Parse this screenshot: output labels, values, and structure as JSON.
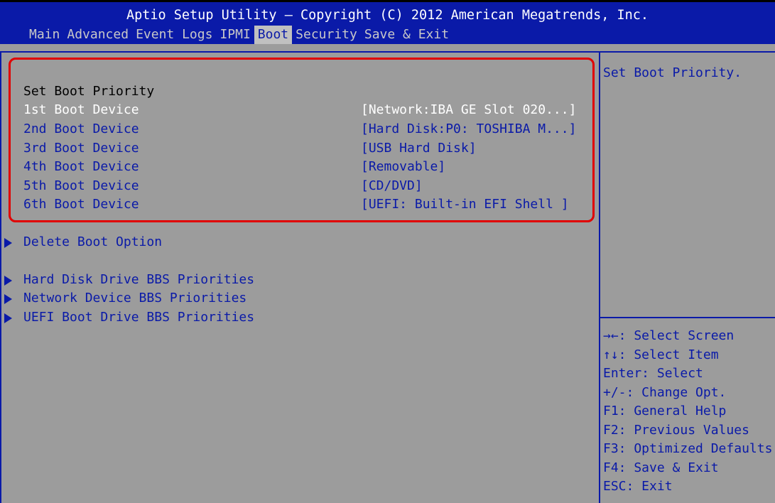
{
  "header": {
    "title": "Aptio Setup Utility – Copyright (C) 2012 American Megatrends, Inc.",
    "tabs": [
      {
        "label": "Main"
      },
      {
        "label": "Advanced"
      },
      {
        "label": "Event Logs"
      },
      {
        "label": "IPMI"
      },
      {
        "label": "Boot"
      },
      {
        "label": "Security"
      },
      {
        "label": "Save & Exit"
      }
    ],
    "active_tab": "Boot"
  },
  "main": {
    "section_title": "Set Boot Priority",
    "boot_devices": [
      {
        "label": "1st Boot Device",
        "value": "[Network:IBA GE Slot 020...]"
      },
      {
        "label": "2nd Boot Device",
        "value": "[Hard Disk:P0: TOSHIBA M...]"
      },
      {
        "label": "3rd Boot Device",
        "value": "[USB Hard Disk]"
      },
      {
        "label": "4th Boot Device",
        "value": "[Removable]"
      },
      {
        "label": "5th Boot Device",
        "value": "[CD/DVD]"
      },
      {
        "label": "6th Boot Device",
        "value": "[UEFI: Built-in EFI Shell ]"
      }
    ],
    "submenus": [
      {
        "label": "Delete Boot Option"
      },
      {
        "label": "Hard Disk Drive BBS Priorities"
      },
      {
        "label": "Network Device BBS Priorities"
      },
      {
        "label": "UEFI Boot Drive BBS Priorities"
      }
    ]
  },
  "help": {
    "description": "Set Boot Priority.",
    "keys": [
      "→←: Select Screen",
      "↑↓: Select Item",
      "Enter: Select",
      "+/-: Change Opt.",
      "F1: General Help",
      "F2: Previous Values",
      "F3: Optimized Defaults",
      "F4: Save & Exit",
      "ESC: Exit"
    ]
  },
  "colors": {
    "background": "#9c9c9c",
    "header_blue": "#0a1aa8",
    "highlight_red": "#e00000",
    "selected_text": "#ffffff"
  }
}
